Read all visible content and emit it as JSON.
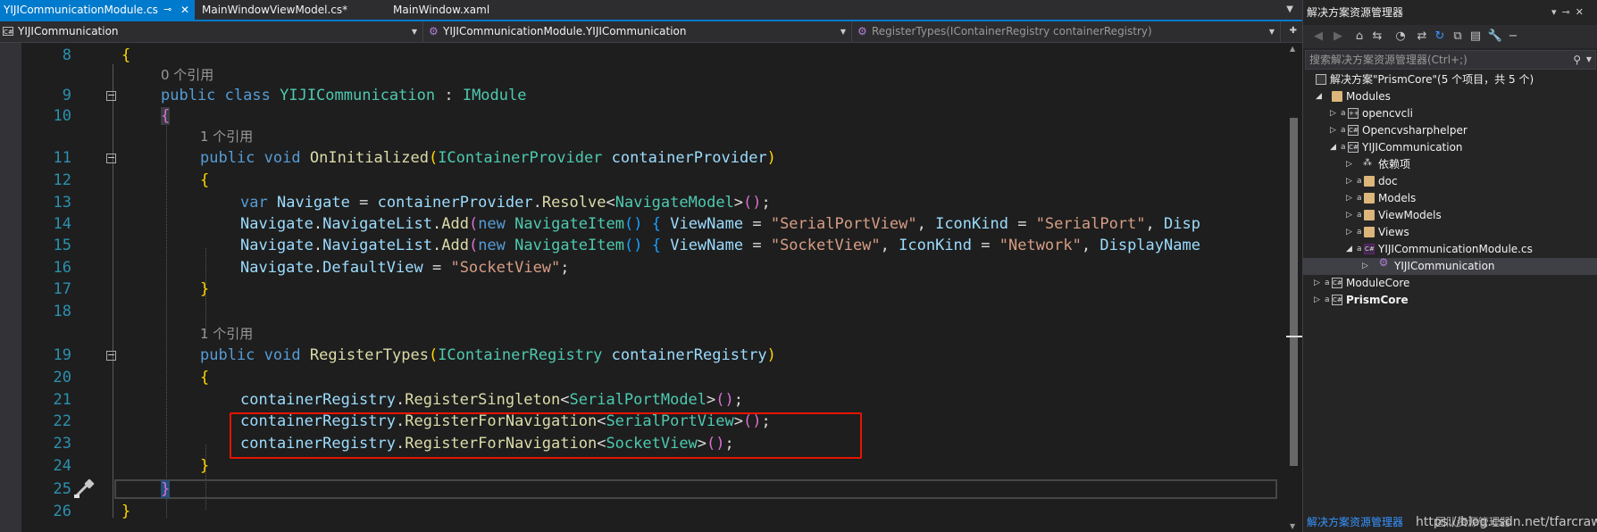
{
  "tabs": [
    {
      "label": "YIJICommunicationModule.cs",
      "active": true
    },
    {
      "label": "MainWindowViewModel.cs*",
      "active": false
    },
    {
      "label": "MainWindow.xaml",
      "active": false
    }
  ],
  "navbar": {
    "project": "YIJICommunication",
    "type": "YIJICommunicationModule.YIJICommunication",
    "member": "RegisterTypes(IContainerRegistry containerRegistry)"
  },
  "editor": {
    "ref_label": "个引用",
    "lines": [
      {
        "num": "8",
        "code": "{"
      },
      {
        "ref": "0 个引用"
      },
      {
        "num": "9",
        "code": "public class YIJICommunication : IModule"
      },
      {
        "num": "10",
        "code": "{"
      },
      {
        "ref": "1 个引用"
      },
      {
        "num": "11",
        "code": "public void OnInitialized(IContainerProvider containerProvider)"
      },
      {
        "num": "12",
        "code": "{"
      },
      {
        "num": "13",
        "code": "var Navigate = containerProvider.Resolve<NavigateModel>();"
      },
      {
        "num": "14",
        "code": "Navigate.NavigateList.Add(new NavigateItem() { ViewName = \"SerialPortView\", IconKind = \"SerialPort\", Disp"
      },
      {
        "num": "15",
        "code": "Navigate.NavigateList.Add(new NavigateItem() { ViewName = \"SocketView\", IconKind = \"Network\", DisplayName"
      },
      {
        "num": "16",
        "code": "Navigate.DefaultView = \"SocketView\";"
      },
      {
        "num": "17",
        "code": "}"
      },
      {
        "num": "18",
        "code": ""
      },
      {
        "ref": "1 个引用"
      },
      {
        "num": "19",
        "code": "public void RegisterTypes(IContainerRegistry containerRegistry)"
      },
      {
        "num": "20",
        "code": "{"
      },
      {
        "num": "21",
        "code": "containerRegistry.RegisterSingleton<SerialPortModel>();"
      },
      {
        "num": "22",
        "code": "containerRegistry.RegisterForNavigation<SerialPortView>();"
      },
      {
        "num": "23",
        "code": "containerRegistry.RegisterForNavigation<SocketView>();"
      },
      {
        "num": "24",
        "code": "}"
      },
      {
        "num": "25",
        "code": "}"
      },
      {
        "num": "26",
        "code": "}"
      }
    ]
  },
  "solution_explorer": {
    "title": "解决方案资源管理器",
    "search_placeholder": "搜索解决方案资源管理器(Ctrl+;)",
    "tree": [
      {
        "label": "解决方案\"PrismCore\"(5 个项目，共 5 个)",
        "depth": 0,
        "icon": "solution-icon"
      },
      {
        "label": "Modules",
        "depth": 1,
        "icon": "folder-icon",
        "expanded": true
      },
      {
        "label": "opencvcli",
        "depth": 2,
        "icon": "cpp-project-icon"
      },
      {
        "label": "Opencvsharphelper",
        "depth": 2,
        "icon": "csharp-project-icon"
      },
      {
        "label": "YIJICommunication",
        "depth": 2,
        "icon": "csharp-project-icon",
        "expanded": true
      },
      {
        "label": "依赖项",
        "depth": 3,
        "icon": "dependencies-icon"
      },
      {
        "label": "doc",
        "depth": 3,
        "icon": "folder-icon"
      },
      {
        "label": "Models",
        "depth": 3,
        "icon": "folder-icon"
      },
      {
        "label": "ViewModels",
        "depth": 3,
        "icon": "folder-icon"
      },
      {
        "label": "Views",
        "depth": 3,
        "icon": "folder-icon"
      },
      {
        "label": "YIJICommunicationModule.cs",
        "depth": 3,
        "icon": "csharp-file-icon",
        "expanded": true
      },
      {
        "label": "YIJICommunication",
        "depth": 4,
        "icon": "class-icon",
        "selected": true
      },
      {
        "label": "ModuleCore",
        "depth": 0,
        "icon": "csharp-project-icon"
      },
      {
        "label": "PrismCore",
        "depth": 0,
        "icon": "csharp-project-icon",
        "bold": true
      }
    ],
    "footer_link": "解决方案资源管理器",
    "watermark_overlay": "团队资源管理器",
    "watermark": "https://blog.csdn.net/tfarcraw"
  },
  "colors": {
    "accent": "#007acc",
    "highlight_box": "#e51400",
    "line_number": "#2b91af",
    "keyword": "#569cd6",
    "type": "#4ec9b0",
    "method": "#dcdcaa",
    "identifier": "#9cdcfe",
    "string": "#d69d85"
  }
}
